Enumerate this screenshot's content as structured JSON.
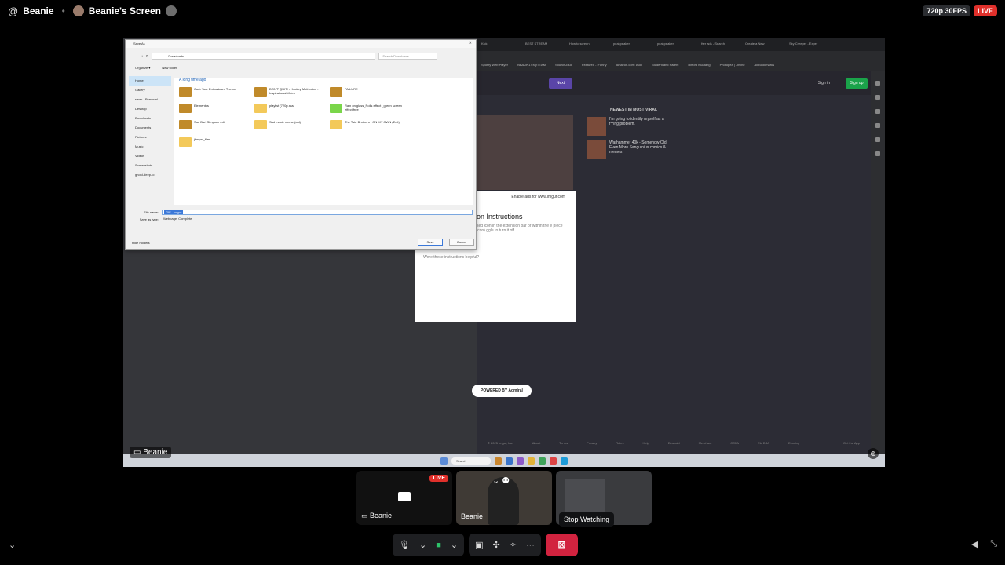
{
  "topbar": {
    "at_icon": "@",
    "username": "Beanie",
    "screen_title": "Beanie's Screen",
    "quality": "720p 30FPS",
    "live": "LIVE"
  },
  "stream": {
    "label": "Beanie",
    "zoom_icon": "zoom-icon",
    "dialog": {
      "title": "Save As",
      "path": "Downloads",
      "search_placeholder": "Search Downloads",
      "toolbar": [
        "Organize ▾",
        "New folder"
      ],
      "nav": [
        "Home",
        "Gallery",
        "swan - Personal",
        "Desktop",
        "Downloads",
        "Documents",
        "Pictures",
        "Music",
        "Videos",
        "Screenshots",
        "ghost-deep-lo"
      ],
      "group_label": "A long time ago",
      "files": [
        {
          "name": "Curb Your Enthusiasm Theme",
          "kind": "video"
        },
        {
          "name": "DON'T QUIT! - Hockey Motivation - Inspirational Video",
          "kind": "video"
        },
        {
          "name": "FAILURE",
          "kind": "video"
        },
        {
          "name": "Elementus",
          "kind": "video"
        },
        {
          "name": "playlist (720p ass)",
          "kind": "folder"
        },
        {
          "name": "Rain on glass_Rolls effect _green screen effect free",
          "kind": "green"
        },
        {
          "name": "Sad Bart Simpson edit",
          "kind": "video"
        },
        {
          "name": "Sad music meme (cut)",
          "kind": "folder"
        },
        {
          "name": "The Tate Brothers - ON MY OWN (Edit)",
          "kind": "folder"
        },
        {
          "name": "jbmpxt_files",
          "kind": "folder"
        }
      ],
      "file_name_label": "File name:",
      "file_name_value": "GIF - Imgur",
      "save_type_label": "Save as type:",
      "save_type_value": "Webpage, Complete",
      "hide_folders": "Hide Folders",
      "save_button": "Save",
      "cancel_button": "Cancel"
    },
    "page": {
      "next_button": "Next",
      "signin": "Sign in",
      "signup": "Sign up",
      "viral_title": "NEWEST IN MOST VIRAL",
      "viral_items": [
        "I'm going to identify myself as a f**ing problem.",
        "Warhammer 40k - Somehow Old Even More Sanguinius comics & memes"
      ],
      "ad_top": "Enable ads for www.imgur.com",
      "ad_heading": "on Instructions",
      "ad_text": "sed icon in the extension bar or within the e piece icon) ggle to turn it off",
      "ad_question": "Were these instructions helpful?",
      "admiral": "POWERED BY Admiral",
      "footer": [
        "© 2025 Imgur, Inc.",
        "About",
        "Terms",
        "Privacy",
        "Rules",
        "Help",
        "Emerald",
        "Merchant",
        "CCPA",
        "EU DSA",
        "Ecosing"
      ],
      "get_app": "Get the App"
    },
    "tabs": [
      "Kick",
      "BEST STREAM",
      "How to screen",
      "peakpeaker",
      "peakpeaker",
      "Ker ads - Search",
      "Create a New",
      "Sky Creeper - Exper"
    ],
    "bookmarks": [
      "Spotify Web Player",
      "NBA 2K17 MyTEAM",
      "SoundCloud",
      "Featured - iFunny",
      "Amazon.com: Audi",
      "Student and Parent",
      "clifford mustang",
      "Photopea | Online",
      "All Bookmarks"
    ],
    "taskbar_search": "Search"
  },
  "tiles": [
    {
      "label": "Beanie",
      "live": "LIVE"
    },
    {
      "label": "Beanie"
    },
    {
      "label": ""
    }
  ],
  "tooltip": "Stop Watching",
  "controls": {
    "mic_icon": "microphone-icon",
    "camera_icon": "camera-icon",
    "share_icon": "screen-share-icon",
    "activities_icon": "activities-icon",
    "soundboard_icon": "soundboard-icon",
    "more_icon": "more-icon",
    "leave_icon": "stop-watching-icon"
  },
  "colors": {
    "live_red": "#e0302b",
    "leave_red": "#d2233f",
    "camera_green": "#2dc36a"
  }
}
